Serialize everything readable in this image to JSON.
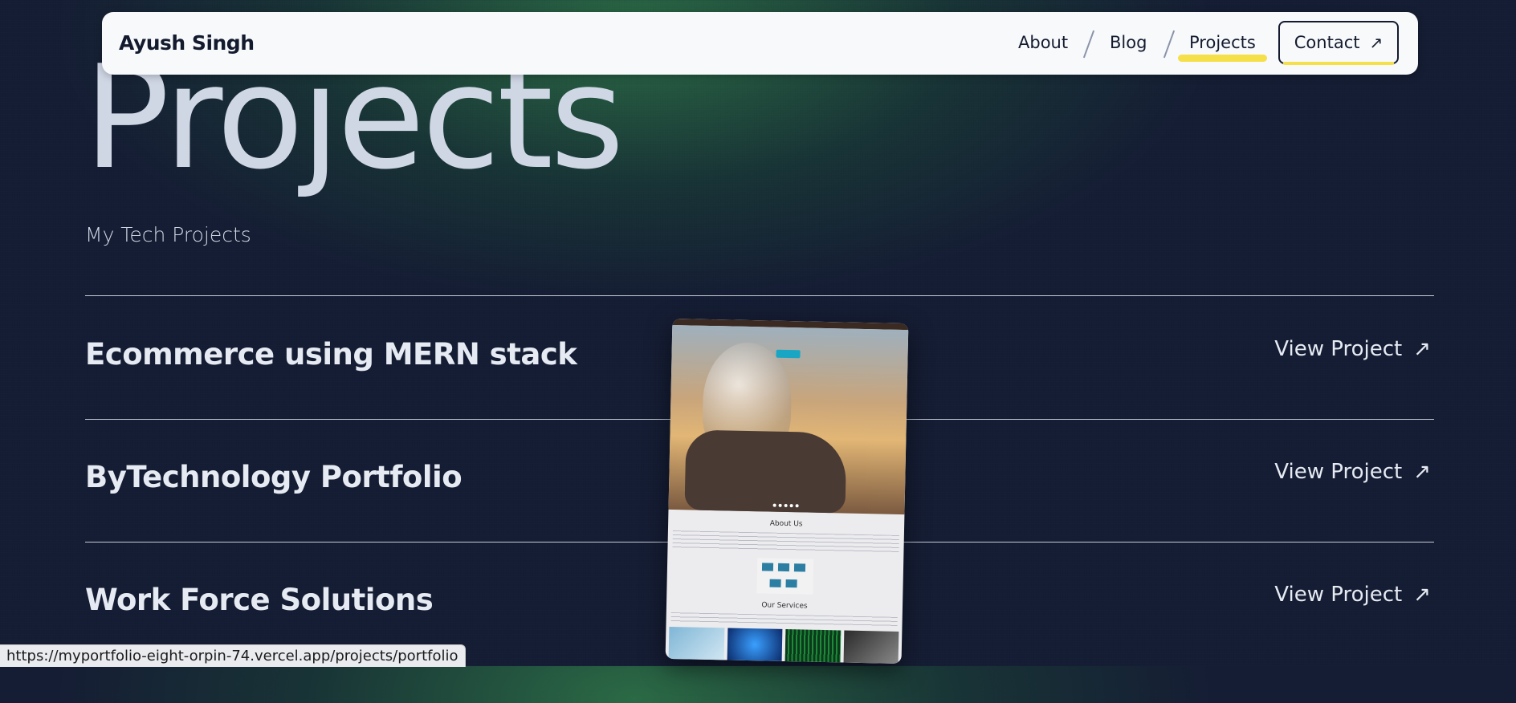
{
  "nav": {
    "brand": "Ayush Singh",
    "items": [
      {
        "label": "About"
      },
      {
        "label": "Blog"
      },
      {
        "label": "Projects",
        "active": true
      }
    ],
    "contact_label": "Contact",
    "arrow_icon": "↗",
    "accent_color": "#f6e049"
  },
  "hero": {
    "title": "Projects",
    "subtitle": "My Tech Projects"
  },
  "projects": [
    {
      "title": "Ecommerce using MERN stack",
      "link_label": "View Project"
    },
    {
      "title": "ByTechnology Portfolio",
      "link_label": "View Project"
    },
    {
      "title": "Work Force Solutions",
      "link_label": "View Project"
    }
  ],
  "preview": {
    "about_heading": "About Us",
    "services_heading": "Our Services"
  },
  "status": {
    "url": "https://myportfolio-eight-orpin-74.vercel.app/projects/portfolio"
  }
}
